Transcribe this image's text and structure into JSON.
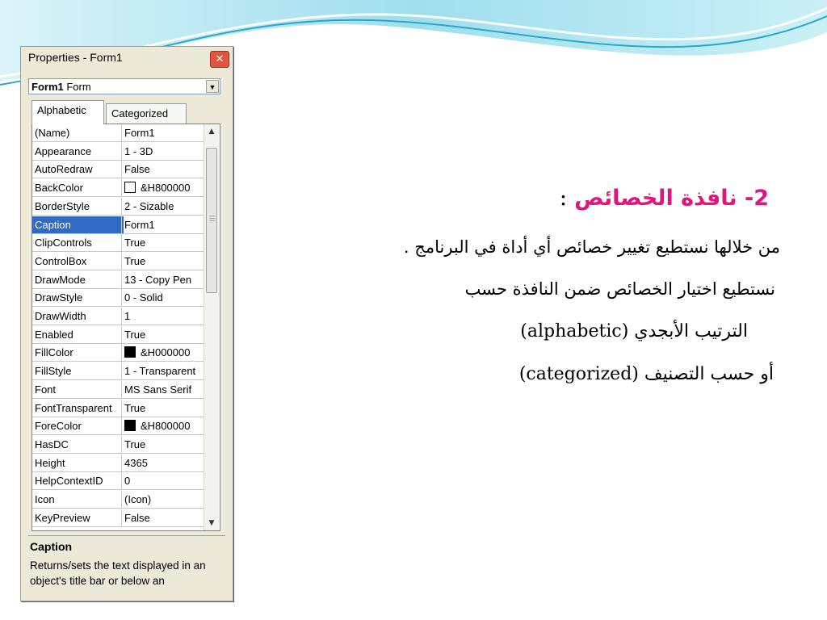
{
  "window": {
    "title": "Properties - Form1",
    "close_glyph": "✕",
    "object_name": "Form1",
    "object_type": "Form",
    "tabs": [
      "Alphabetic",
      "Categorized"
    ]
  },
  "properties": [
    {
      "name": "(Name)",
      "value": "Form1"
    },
    {
      "name": "Appearance",
      "value": "1 - 3D"
    },
    {
      "name": "AutoRedraw",
      "value": "False"
    },
    {
      "name": "BackColor",
      "value": "&H800000",
      "swatch": "#ffffff"
    },
    {
      "name": "BorderStyle",
      "value": "2 - Sizable"
    },
    {
      "name": "Caption",
      "value": "Form1",
      "selected": true
    },
    {
      "name": "ClipControls",
      "value": "True"
    },
    {
      "name": "ControlBox",
      "value": "True"
    },
    {
      "name": "DrawMode",
      "value": "13 - Copy Pen"
    },
    {
      "name": "DrawStyle",
      "value": "0 - Solid"
    },
    {
      "name": "DrawWidth",
      "value": "1"
    },
    {
      "name": "Enabled",
      "value": "True"
    },
    {
      "name": "FillColor",
      "value": "&H000000",
      "swatch": "#000000"
    },
    {
      "name": "FillStyle",
      "value": "1 - Transparent"
    },
    {
      "name": "Font",
      "value": "MS Sans Serif"
    },
    {
      "name": "FontTransparent",
      "value": "True"
    },
    {
      "name": "ForeColor",
      "value": "&H800000",
      "swatch": "#000000"
    },
    {
      "name": "HasDC",
      "value": "True"
    },
    {
      "name": "Height",
      "value": "4365"
    },
    {
      "name": "HelpContextID",
      "value": "0"
    },
    {
      "name": "Icon",
      "value": "(Icon)"
    },
    {
      "name": "KeyPreview",
      "value": "False"
    }
  ],
  "description": {
    "title": "Caption",
    "text": "Returns/sets the text displayed in an object's title bar or below an"
  },
  "slide": {
    "heading": "2- نافذة الخصائص",
    "heading_suffix": ":",
    "line1": "من خلالها نستطيع تغيير خصائص أي أداة في البرنامج .",
    "line2": "نستطيع اختيار الخصائص ضمن النافذة حسب",
    "line3": "الترتيب الأبجدي (alphabetic)",
    "line4": "أو حسب التصنيف (categorized)"
  },
  "colors": {
    "heading": "#e0157e",
    "selection": "#3169c6",
    "close_button": "#e0553c"
  }
}
